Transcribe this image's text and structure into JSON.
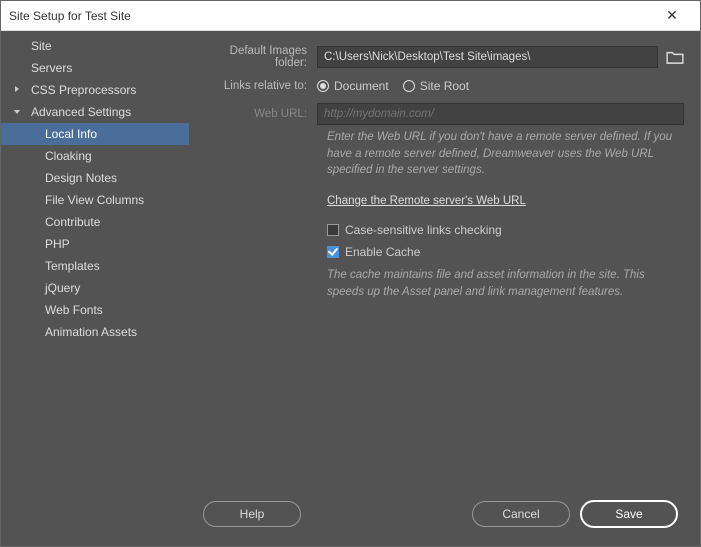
{
  "title": "Site Setup for Test Site",
  "sidebar": {
    "site": "Site",
    "servers": "Servers",
    "css": "CSS Preprocessors",
    "advanced": "Advanced Settings",
    "sub": {
      "local": "Local Info",
      "cloaking": "Cloaking",
      "design": "Design Notes",
      "fileview": "File View Columns",
      "contribute": "Contribute",
      "php": "PHP",
      "templates": "Templates",
      "jquery": "jQuery",
      "webfonts": "Web Fonts",
      "anim": "Animation Assets"
    }
  },
  "form": {
    "images_label": "Default Images folder:",
    "images_value": "C:\\Users\\Nick\\Desktop\\Test Site\\images\\",
    "links_label": "Links relative to:",
    "radio_doc": "Document",
    "radio_root": "Site Root",
    "weburl_label": "Web URL:",
    "weburl_placeholder": "http://mydomain.com/",
    "weburl_help": "Enter the Web URL if you don't have a remote server defined. If you have a remote server defined, Dreamweaver uses the Web URL specified in the server settings.",
    "change_link": "Change the Remote server's Web URL",
    "case_label": "Case-sensitive links checking",
    "cache_label": "Enable Cache",
    "cache_help": "The cache maintains file and asset information in the site. This speeds up the Asset panel and link management features."
  },
  "buttons": {
    "help": "Help",
    "cancel": "Cancel",
    "save": "Save"
  }
}
